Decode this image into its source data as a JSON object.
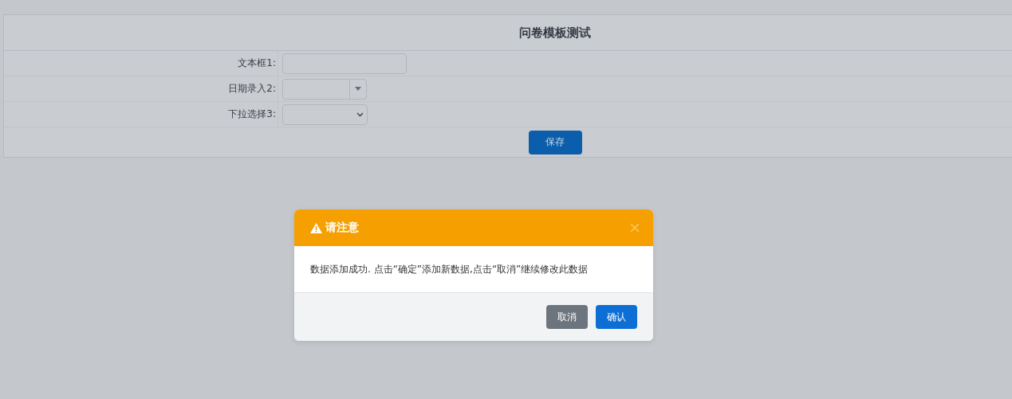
{
  "form": {
    "title": "问卷模板测试",
    "fields": [
      {
        "kind": "text",
        "label": "文本框1:"
      },
      {
        "kind": "date",
        "label": "日期录入2:"
      },
      {
        "kind": "select",
        "label": "下拉选择3:"
      }
    ],
    "save_button": "保存"
  },
  "dialog": {
    "title": "请注意",
    "message": "数据添加成功. 点击“确定”添加新数据,点击“取消”继续修改此数据",
    "buttons": [
      {
        "kind": "secondary",
        "label": "取消"
      },
      {
        "kind": "primary",
        "label": "确认"
      }
    ]
  }
}
